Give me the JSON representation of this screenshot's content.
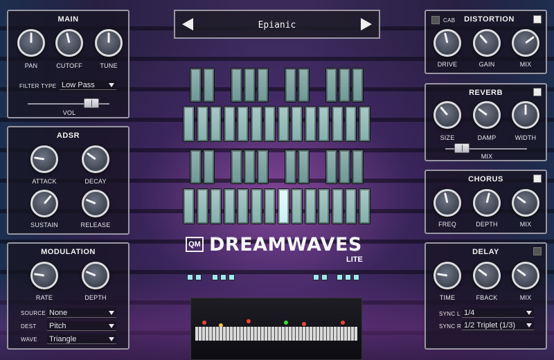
{
  "preset": {
    "name": "Epianic"
  },
  "logo": {
    "badge": "QM",
    "title": "DREAMWAVES",
    "subtitle": "LITE"
  },
  "main": {
    "title": "MAIN",
    "knobs": [
      {
        "label": "PAN",
        "value": 0.5
      },
      {
        "label": "CUTOFF",
        "value": 0.45
      },
      {
        "label": "TUNE",
        "value": 0.5
      }
    ],
    "filter_type_label": "FILTER TYPE",
    "filter_type_value": "Low Pass",
    "vol_label": "VOL",
    "vol_value": 0.78
  },
  "adsr": {
    "title": "ADSR",
    "knobs": [
      {
        "label": "ATTACK",
        "value": 0.2
      },
      {
        "label": "DECAY",
        "value": 0.3
      },
      {
        "label": "SUSTAIN",
        "value": 0.65
      },
      {
        "label": "RELEASE",
        "value": 0.25
      }
    ]
  },
  "modulation": {
    "title": "MODULATION",
    "knobs": [
      {
        "label": "RATE",
        "value": 0.2
      },
      {
        "label": "DEPTH",
        "value": 0.25
      }
    ],
    "source_label": "SOURCE",
    "source_value": "None",
    "dest_label": "DEST",
    "dest_value": "Pitch",
    "wave_label": "WAVE",
    "wave_value": "Triangle"
  },
  "distortion": {
    "title": "DISTORTION",
    "cab_label": "CAB",
    "enabled": true,
    "knobs": [
      {
        "label": "DRIVE",
        "value": 0.45
      },
      {
        "label": "GAIN",
        "value": 0.35
      },
      {
        "label": "MIX",
        "value": 0.7
      }
    ]
  },
  "reverb": {
    "title": "REVERB",
    "enabled": true,
    "knobs": [
      {
        "label": "SIZE",
        "value": 0.35
      },
      {
        "label": "DAMP",
        "value": 0.3
      },
      {
        "label": "WIDTH",
        "value": 0.5
      }
    ],
    "mix_label": "MIX",
    "mix_value": 0.2
  },
  "chorus": {
    "title": "CHORUS",
    "enabled": true,
    "knobs": [
      {
        "label": "FREQ",
        "value": 0.45
      },
      {
        "label": "DEPTH",
        "value": 0.55
      },
      {
        "label": "MIX",
        "value": 0.3
      }
    ]
  },
  "delay": {
    "title": "DELAY",
    "enabled": false,
    "knobs": [
      {
        "label": "TIME",
        "value": 0.2
      },
      {
        "label": "FBACK",
        "value": 0.3
      },
      {
        "label": "MIX",
        "value": 0.3
      }
    ],
    "sync_l_label": "SYNC L",
    "sync_l_value": "1/4",
    "sync_r_label": "SYNC R",
    "sync_r_value": "1/2 Triplet (1/3)"
  },
  "colors": {
    "panel_border": "#9a98a4",
    "pad": "#85b0ad",
    "pad_lit": "#e6fbff",
    "accent": "#9fe8f2"
  }
}
